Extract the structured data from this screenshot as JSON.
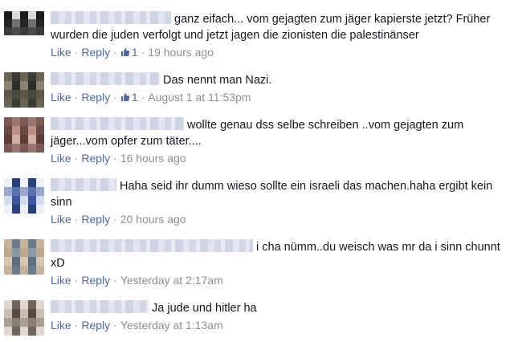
{
  "actions": {
    "like": "Like",
    "reply": "Reply",
    "separator": "·"
  },
  "comments": [
    {
      "text": "ganz eifach... vom gejagten zum jäger kapierste jetzt? Früher wurden die juden verfolgt und jetzt jagen die zionisten die palestinänser",
      "likes": "1",
      "time": "19 hours ago",
      "avatar_colors": [
        "#1a1a1a",
        "#4b4b4b",
        "#262626",
        "#d9d9d9",
        "#3a3a3a",
        "#707070"
      ]
    },
    {
      "text": "Das nennt man Nazi.",
      "likes": "1",
      "time": "August 1 at 11:53pm",
      "avatar_colors": [
        "#2e2f2a",
        "#6b6455",
        "#474a3f",
        "#8c8270",
        "#3a3b33",
        "#5d5649"
      ]
    },
    {
      "text": "wollte genau dss selbe schreiben ..vom gejagten zum jäger...vom opfer zum täter....",
      "likes": "",
      "time": "16 hours ago",
      "avatar_colors": [
        "#5a3b36",
        "#b98f86",
        "#7e5a54",
        "#d1aea7",
        "#6a4a44",
        "#9c776f"
      ]
    },
    {
      "text": "Haha seid ihr dumm wieso sollte ein israeli das machen.haha ergibt kein sinn",
      "likes": "",
      "time": "20 hours ago",
      "avatar_colors": [
        "#28407e",
        "#d5dcee",
        "#5b73ad",
        "#eef1f8",
        "#3b55a0",
        "#9aa7cc"
      ]
    },
    {
      "text": "i cha nümm..du weisch was mr da i sinn chunnt xD",
      "likes": "",
      "time": "Yesterday at 2:17am",
      "avatar_colors": [
        "#bca68c",
        "#6a7b8e",
        "#d7c7b2",
        "#8a97a4",
        "#c7b39c",
        "#5f6e7c"
      ]
    },
    {
      "text": "Ja jude und hitler ha",
      "likes": "",
      "time": "Yesterday at 1:13am",
      "avatar_colors": [
        "#8a7c71",
        "#c9bfb5",
        "#6f645c",
        "#ab9f94",
        "#554b45",
        "#e0d8d0"
      ]
    }
  ]
}
